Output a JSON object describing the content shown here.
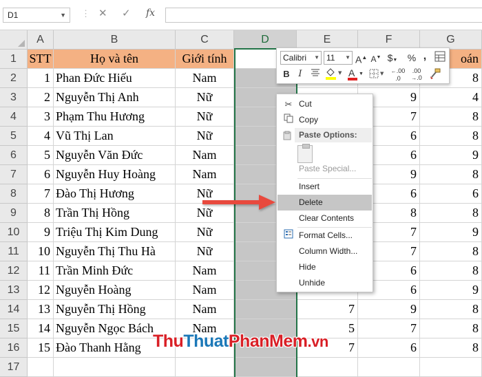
{
  "formula_bar": {
    "name_box": "D1",
    "cancel_icon": "✕",
    "enter_icon": "✓",
    "fx_label": "fx",
    "formula": ""
  },
  "columns": [
    "A",
    "B",
    "C",
    "D",
    "E",
    "F",
    "G"
  ],
  "rows": [
    "1",
    "2",
    "3",
    "4",
    "5",
    "6",
    "7",
    "8",
    "9",
    "10",
    "11",
    "12",
    "13",
    "14",
    "15",
    "16",
    "17"
  ],
  "headers": {
    "stt": "STT",
    "name": "Họ và tên",
    "gender": "Giới tính",
    "g_partial": "oán"
  },
  "data": [
    {
      "stt": "1",
      "name": "Phan Đức Hiếu",
      "gender": "Nam",
      "e": "",
      "f": "",
      "g": "8"
    },
    {
      "stt": "2",
      "name": "Nguyễn Thị Anh",
      "gender": "Nữ",
      "e": "",
      "f": "9",
      "g": "4"
    },
    {
      "stt": "3",
      "name": "Phạm Thu Hương",
      "gender": "Nữ",
      "e": "",
      "f": "7",
      "g": "8"
    },
    {
      "stt": "4",
      "name": "Vũ Thị Lan",
      "gender": "Nữ",
      "e": "",
      "f": "6",
      "g": "8"
    },
    {
      "stt": "5",
      "name": "Nguyễn Văn Đức",
      "gender": "Nam",
      "e": "",
      "f": "6",
      "g": "9"
    },
    {
      "stt": "6",
      "name": "Nguyễn Huy Hoàng",
      "gender": "Nam",
      "e": "",
      "f": "9",
      "g": "8"
    },
    {
      "stt": "7",
      "name": "Đào Thị Hương",
      "gender": "Nữ",
      "e": "",
      "f": "6",
      "g": "6"
    },
    {
      "stt": "8",
      "name": "Trần Thị Hồng",
      "gender": "Nữ",
      "e": "",
      "f": "8",
      "g": "8"
    },
    {
      "stt": "9",
      "name": "Triệu Thị Kim Dung",
      "gender": "Nữ",
      "e": "",
      "f": "7",
      "g": "9"
    },
    {
      "stt": "10",
      "name": "Nguyễn Thị Thu Hà",
      "gender": "Nữ",
      "e": "",
      "f": "7",
      "g": "8"
    },
    {
      "stt": "11",
      "name": "Trần Minh Đức",
      "gender": "Nam",
      "e": "",
      "f": "6",
      "g": "8"
    },
    {
      "stt": "12",
      "name": "Nguyễn Hoàng",
      "gender": "Nam",
      "e": "",
      "f": "6",
      "g": "9"
    },
    {
      "stt": "13",
      "name": "Nguyễn Thị Hồng",
      "gender": "Nam",
      "e": "7",
      "f": "9",
      "g": "8"
    },
    {
      "stt": "14",
      "name": "Nguyễn Ngọc Bách",
      "gender": "Nam",
      "e": "5",
      "f": "7",
      "g": "8"
    },
    {
      "stt": "15",
      "name": "Đào Thanh Hằng",
      "gender": "",
      "e": "7",
      "f": "6",
      "g": "8"
    }
  ],
  "mini_toolbar": {
    "font": "Calibri",
    "size": "11",
    "grow_font": "A",
    "shrink_font": "A",
    "currency": "$",
    "percent": "%",
    "comma": ",",
    "bold": "B",
    "italic": "I",
    "font_color": "A",
    "dec_increase": ".00",
    "dec_decrease": ".00",
    "font_color_hex": "#e02020",
    "fill_color_hex": "#ffff00"
  },
  "context_menu": {
    "items": [
      {
        "label": "Cut"
      },
      {
        "label": "Copy"
      },
      {
        "label": "Paste Options:"
      },
      {
        "label": "Paste Special..."
      },
      {
        "label": "Insert"
      },
      {
        "label": "Delete"
      },
      {
        "label": "Clear Contents"
      },
      {
        "label": "Format Cells..."
      },
      {
        "label": "Column Width..."
      },
      {
        "label": "Hide"
      },
      {
        "label": "Unhide"
      }
    ]
  },
  "watermark": {
    "part1": "Thu",
    "part2": "Thuat",
    "part3": "PhanMem",
    "part4": ".vn"
  },
  "colors": {
    "header_fill": "#f4b183",
    "selection_border": "#217346",
    "selected_col": "#c6c6c6",
    "arrow": "#e84a3c"
  }
}
